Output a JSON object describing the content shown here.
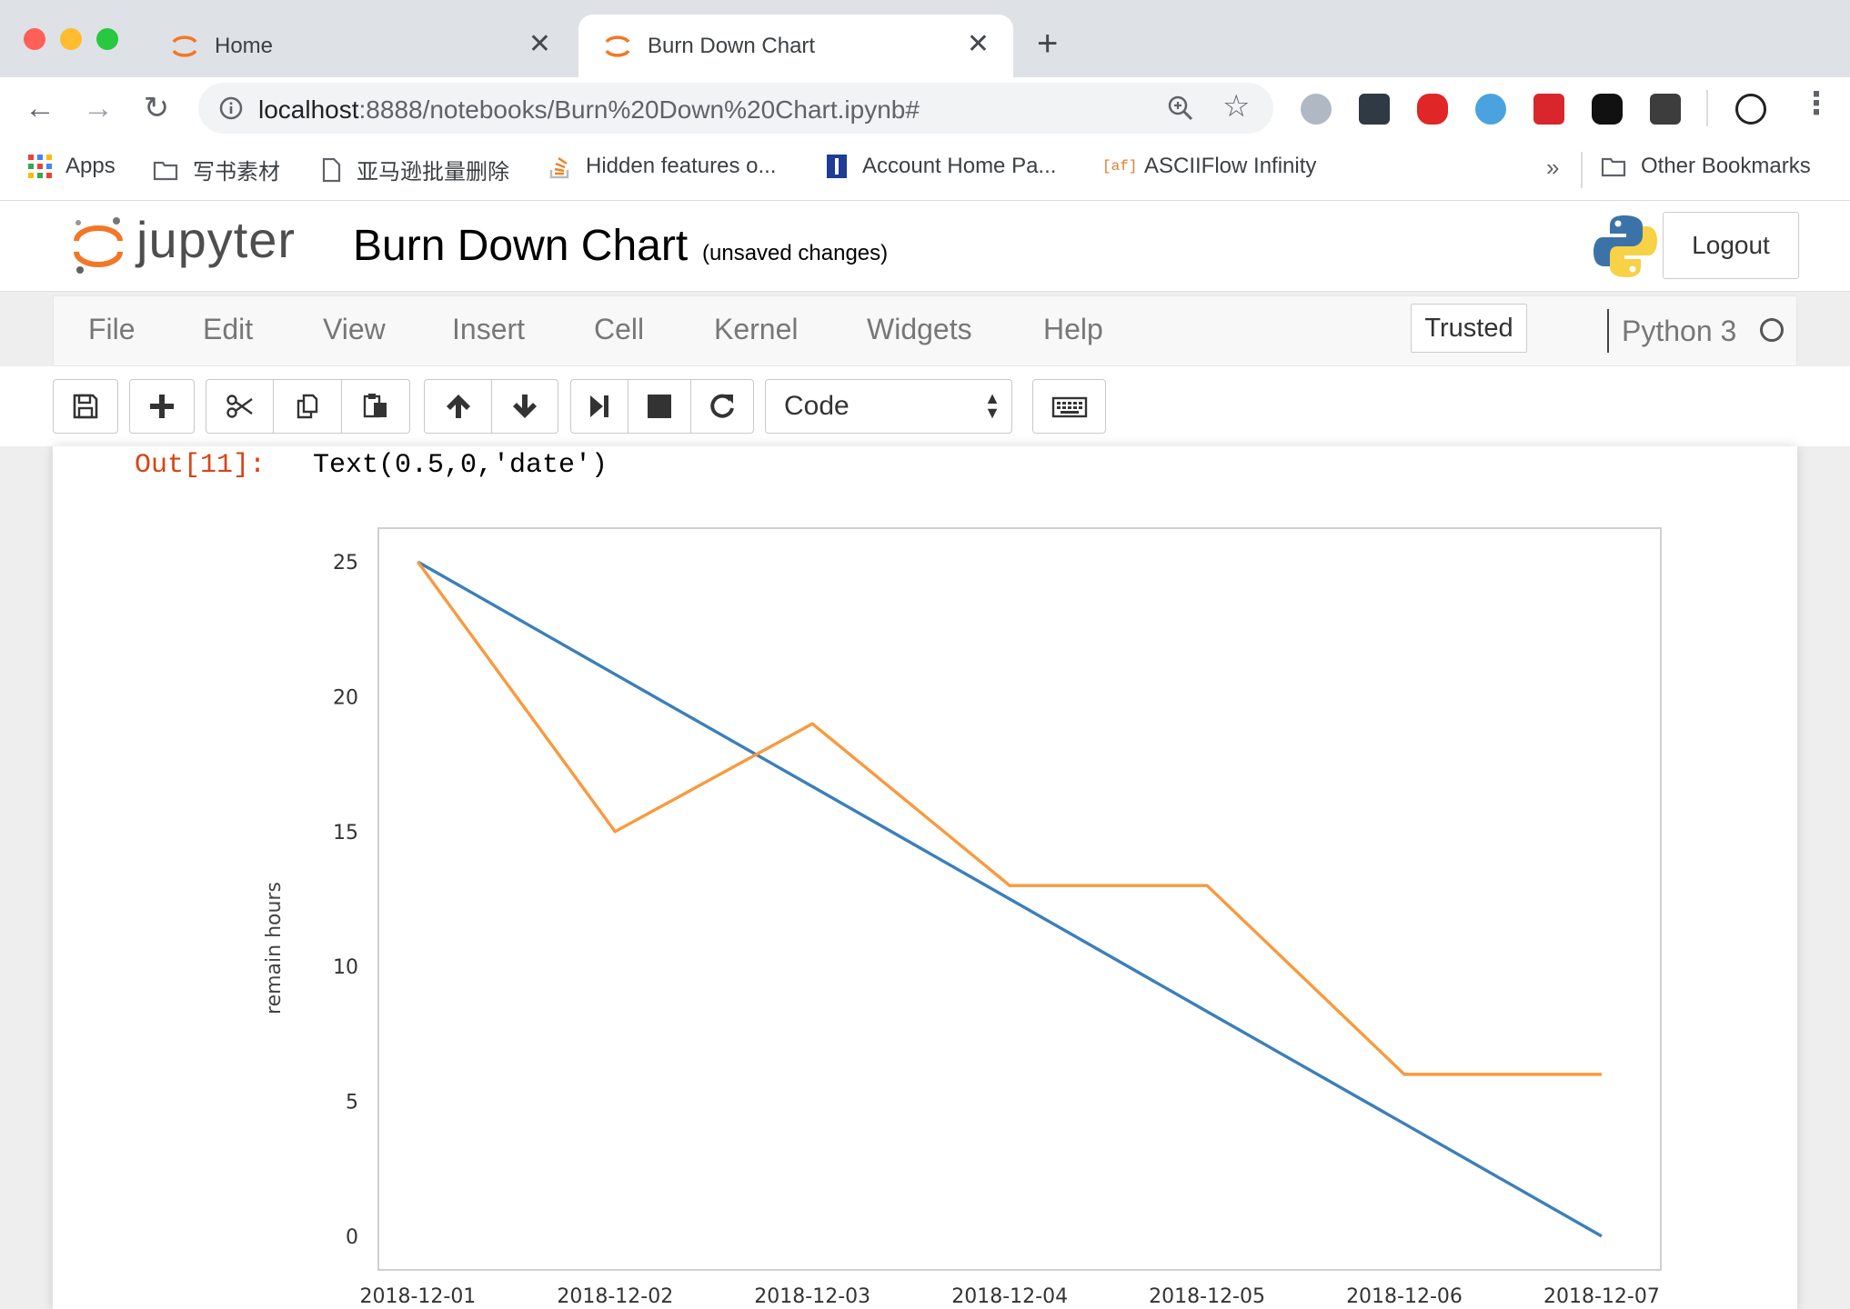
{
  "browser": {
    "tabs": [
      {
        "title": "Home",
        "active": false
      },
      {
        "title": "Burn Down Chart",
        "active": true
      }
    ],
    "url_host": "localhost",
    "url_rest": ":8888/notebooks/Burn%20Down%20Chart.ipynb#",
    "bookmarks": [
      {
        "label": "Apps",
        "icon": "apps-grid-icon"
      },
      {
        "label": "写书素材",
        "icon": "folder-icon"
      },
      {
        "label": "亚马逊批量删除",
        "icon": "page-icon"
      },
      {
        "label": "Hidden features o...",
        "icon": "stackoverflow-icon"
      },
      {
        "label": "Account Home Pa...",
        "icon": "account-icon"
      },
      {
        "label": "ASCIIFlow Infinity",
        "icon": "asciiflow-icon"
      }
    ],
    "bookmarks_overflow": "»",
    "other_bookmarks": "Other Bookmarks"
  },
  "jupyter": {
    "logo_text": "jupyter",
    "notebook_title": "Burn Down Chart",
    "save_status": "(unsaved changes)",
    "logout_label": "Logout",
    "menu": [
      "File",
      "Edit",
      "View",
      "Insert",
      "Cell",
      "Kernel",
      "Widgets",
      "Help"
    ],
    "trusted_label": "Trusted",
    "kernel_name": "Python 3",
    "cell_type": "Code"
  },
  "output": {
    "prompt": "Out[11]:",
    "text": "Text(0.5,0,'date')"
  },
  "chart_data": {
    "type": "line",
    "x": [
      "2018-12-01",
      "2018-12-02",
      "2018-12-03",
      "2018-12-04",
      "2018-12-05",
      "2018-12-06",
      "2018-12-07"
    ],
    "series": [
      {
        "values": [
          25,
          20.83,
          16.67,
          12.5,
          8.33,
          4.17,
          0
        ],
        "color": "#3b7fba"
      },
      {
        "values": [
          25,
          15,
          19,
          13,
          13,
          6,
          6
        ],
        "color": "#f89a3e"
      }
    ],
    "yticks": [
      "0",
      "5",
      "10",
      "15",
      "20",
      "25"
    ],
    "ylabel": "remain hours",
    "ylim": [
      -1.25,
      26.25
    ],
    "grid": true
  }
}
